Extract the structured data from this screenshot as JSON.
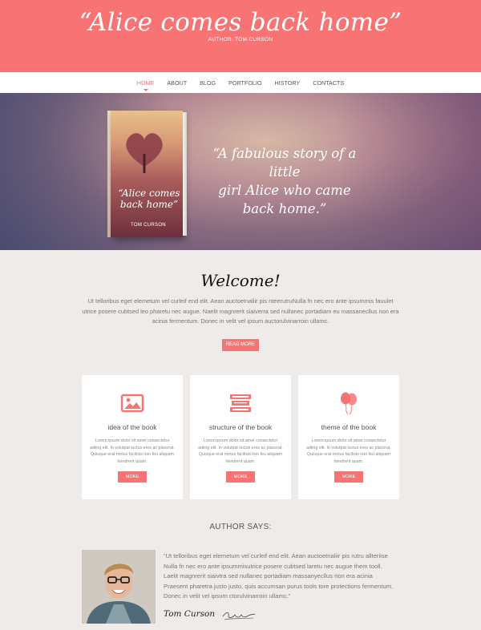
{
  "header": {
    "title": "“Alice comes back home”",
    "subtitle": "AUTHOR: TOM CURSON"
  },
  "nav": {
    "items": [
      "HOME",
      "ABOUT",
      "BLOG",
      "PORTFOLIO",
      "HISTORY",
      "CONTACTS"
    ],
    "active": "HOME"
  },
  "hero": {
    "book": {
      "title_line1": "“Alice comes",
      "title_line2": "back home”",
      "author": "TOM CURSON"
    },
    "quote_line1": "“A fabulous story of a little",
    "quote_line2": "girl Alice who came",
    "quote_line3": "back home.”"
  },
  "welcome": {
    "title": "Welcome!",
    "text": "Ut telloribus eget elemetum vel curleif end elit. Aean auctoetnaliir pis nteerutruNulla fn nec ero ante ipsummis fauulet utrice posere cubtsed leo pharetu nec augue. Naelit magnrerit siaiverra sed nullanec portadiam eu massanecllus non era acinia fermentum. Donec in velit vel ipsum auctorulvinarroin ullamc.",
    "button": "READ MORE"
  },
  "cards": [
    {
      "icon": "image-icon",
      "title": "idea of the book",
      "text": "Lorem ipsum dolor sit amet consectetur adiing elit. In volutpat luctus eros ac placerat. Quisque erat metus facilisis non feu aliquam hendrerit quam.",
      "button": "MORE"
    },
    {
      "icon": "books-icon",
      "title": "structure of the book",
      "text": "Lorem ipsum dolor sit amet consectetur adiing elit. In volutpat luctus eros ac placerat. Quisque erat metus facilisis non feu aliquam hendrerit quam.",
      "button": "MORE"
    },
    {
      "icon": "balloons-icon",
      "title": "theme of the book",
      "text": "Lorem ipsum dolor sit amet consectetur adiing elit. In volutpat luctus eros ac placerat. Quisque erat metus facilisis non feu aliquam hendrerit quam.",
      "button": "MORE"
    }
  ],
  "author_says": {
    "heading": "AUTHOR SAYS:",
    "quote": "“Ut telloribus eget elemetum vel curleif end elit. Aean auctoetnaliir pis rutru allteriise Nulla fn nec ero ante ipsummisutrice posere cubtsed laretu nec augue them tooll. Laelit magnrerit siaivtra sed nullanec portadiam massanyecllus non era acinia Praesent pharetra justo justo, quis accumsan purus tools tore protections fermentum. Donec in velit vel ipsum ctorulvinarroin ullamc.”",
    "name": "Tom Curson"
  },
  "colors": {
    "accent": "#f77374",
    "background": "#efebe8",
    "nav_background": "#ffffff"
  }
}
